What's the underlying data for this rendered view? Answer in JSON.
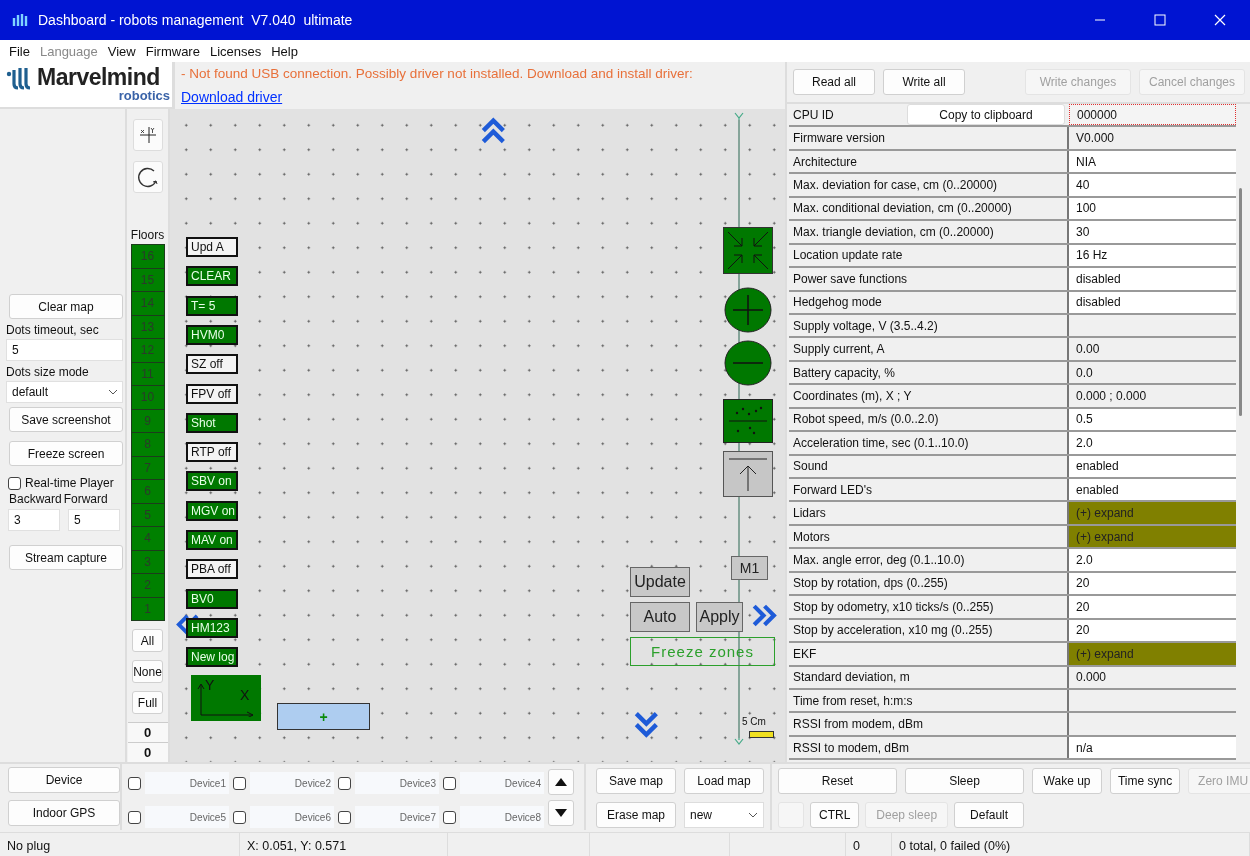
{
  "window": {
    "title": "Dashboard - robots management  V7.040  ultimate"
  },
  "menu": [
    {
      "label": "File",
      "disabled": false
    },
    {
      "label": "Language",
      "disabled": true
    },
    {
      "label": "View",
      "disabled": false
    },
    {
      "label": "Firmware",
      "disabled": false
    },
    {
      "label": "Licenses",
      "disabled": false
    },
    {
      "label": "Help",
      "disabled": false
    }
  ],
  "logo": {
    "name": "Marvelmind",
    "sub": "robotics"
  },
  "message": {
    "text": "- Not found USB connection. Possibly driver not installed. Download and install driver:",
    "link": "Download driver"
  },
  "left_panel": {
    "clear_map": "Clear map",
    "dots_timeout": {
      "label": "Dots timeout, sec",
      "value": "5"
    },
    "dots_size_mode": {
      "label": "Dots size mode",
      "value": "default"
    },
    "save_screenshot": "Save screenshot",
    "freeze_screen": "Freeze screen",
    "realtime_player": {
      "label": "Real-time Player",
      "checked": false
    },
    "backward": {
      "label": "Backward",
      "value": "3"
    },
    "forward": {
      "label": "Forward",
      "value": "5"
    },
    "stream_capture": "Stream capture"
  },
  "floors": {
    "title": "Floors",
    "items": [
      "16",
      "15",
      "14",
      "13",
      "12",
      "11",
      "10",
      "9",
      "8",
      "7",
      "6",
      "5",
      "4",
      "3",
      "2",
      "1"
    ],
    "buttons": [
      "All",
      "None",
      "Full"
    ],
    "counters": [
      "0",
      "0"
    ]
  },
  "map": {
    "toggles": [
      {
        "label": "Upd A",
        "on": false
      },
      {
        "label": "CLEAR",
        "on": true
      },
      {
        "label": "T= 5",
        "on": true
      },
      {
        "label": "HVM0",
        "on": true
      },
      {
        "label": "SZ off",
        "on": false
      },
      {
        "label": "FPV off",
        "on": false
      },
      {
        "label": "Shot",
        "on": true
      },
      {
        "label": "RTP off",
        "on": false
      },
      {
        "label": "SBV on",
        "on": true
      },
      {
        "label": "MGV on",
        "on": true
      },
      {
        "label": "MAV on",
        "on": true
      },
      {
        "label": "PBA off",
        "on": false
      },
      {
        "label": "BV0",
        "on": true
      },
      {
        "label": "HM123",
        "on": true
      },
      {
        "label": "New log",
        "on": true
      }
    ],
    "m1": "M1",
    "update": "Update",
    "auto": "Auto",
    "apply": "Apply",
    "freeze_zones": "Freeze zones",
    "scale": "5 Cm",
    "axis_x": "X",
    "axis_y": "Y",
    "add": "+"
  },
  "params": {
    "toolbar": [
      {
        "label": "Read all",
        "disabled": false
      },
      {
        "label": "Write all",
        "disabled": false
      },
      {
        "label": "Write changes",
        "disabled": true
      },
      {
        "label": "Cancel changes",
        "disabled": true
      }
    ],
    "cpu": {
      "label": "CPU ID",
      "button": "Copy to clipboard",
      "value": "000000"
    },
    "rows": [
      {
        "name": "Firmware version",
        "value": "V0.000",
        "kind": "readonly"
      },
      {
        "name": "Architecture",
        "value": "NIA",
        "kind": "editable"
      },
      {
        "name": "Max. deviation for case, cm (0..20000)",
        "value": "40",
        "kind": "editable"
      },
      {
        "name": "Max. conditional deviation, cm (0..20000)",
        "value": "100",
        "kind": "editable"
      },
      {
        "name": "Max. triangle deviation, cm (0..20000)",
        "value": "30",
        "kind": "editable"
      },
      {
        "name": "Location update rate",
        "value": "16 Hz",
        "kind": "editable"
      },
      {
        "name": "Power save functions",
        "value": "disabled",
        "kind": "editable"
      },
      {
        "name": "Hedgehog mode",
        "value": "disabled",
        "kind": "editable"
      },
      {
        "name": "Supply voltage, V (3.5..4.2)",
        "kind": "readonly"
      },
      {
        "name": "Supply current, A",
        "value": "0.00",
        "kind": "readonly"
      },
      {
        "name": "Battery capacity, %",
        "value": "0.0",
        "kind": "readonly"
      },
      {
        "name": "Coordinates (m), X ; Y",
        "value": "0.000 ; 0.000",
        "kind": "readonly"
      },
      {
        "name": "Robot speed, m/s (0.0..2.0)",
        "value": "0.5",
        "kind": "editable"
      },
      {
        "name": "Acceleration time, sec (0.1..10.0)",
        "value": "2.0",
        "kind": "editable"
      },
      {
        "name": "Sound",
        "value": "enabled",
        "kind": "editable"
      },
      {
        "name": "Forward LED's",
        "value": "enabled",
        "kind": "editable"
      },
      {
        "name": "Lidars",
        "value": "(+) expand",
        "kind": "expand"
      },
      {
        "name": "Motors",
        "value": "(+) expand",
        "kind": "expand"
      },
      {
        "name": "Max. angle error, deg (0.1..10.0)",
        "value": "2.0",
        "kind": "editable"
      },
      {
        "name": "Stop by rotation, dps (0..255)",
        "value": "20",
        "kind": "editable"
      },
      {
        "name": "Stop by odometry, x10 ticks/s (0..255)",
        "value": "20",
        "kind": "editable"
      },
      {
        "name": "Stop by acceleration, x10 mg (0..255)",
        "value": "20",
        "kind": "editable"
      },
      {
        "name": "EKF",
        "value": "(+) expand",
        "kind": "expand"
      },
      {
        "name": "Standard deviation, m",
        "value": "0.000",
        "kind": "readonly"
      },
      {
        "name": "Time from reset, h:m:s",
        "kind": "readonly"
      },
      {
        "name": "RSSI from modem, dBm",
        "kind": "readonly"
      },
      {
        "name": "RSSI to modem, dBm",
        "value": "n/a",
        "kind": "editable"
      }
    ]
  },
  "bottom": {
    "tabs": [
      "Device",
      "Indoor GPS"
    ],
    "devices": [
      {
        "label": "Device1",
        "checked": false
      },
      {
        "label": "Device2",
        "checked": false
      },
      {
        "label": "Device3",
        "checked": false
      },
      {
        "label": "Device4",
        "checked": false
      },
      {
        "label": "Device5",
        "checked": false
      },
      {
        "label": "Device6",
        "checked": false
      },
      {
        "label": "Device7",
        "checked": false
      },
      {
        "label": "Device8",
        "checked": false
      }
    ],
    "map_buttons": [
      "Save map",
      "Load map",
      "Erase map"
    ],
    "map_select": "new",
    "robot_buttons": [
      {
        "label": "Reset",
        "disabled": false
      },
      {
        "label": "Sleep",
        "disabled": false
      },
      {
        "label": "Wake up",
        "disabled": false
      },
      {
        "label": "Time sync",
        "disabled": false
      },
      {
        "label": "Zero IMU",
        "disabled": true
      },
      {
        "label": "CTRL",
        "disabled": false
      },
      {
        "label": "Deep sleep",
        "disabled": true
      },
      {
        "label": "Default",
        "disabled": false
      }
    ]
  },
  "status_bar": {
    "plug": "No plug",
    "position": "X: 0.051, Y: 0.571",
    "count": "0",
    "summary": "0 total, 0 failed (0%)"
  }
}
